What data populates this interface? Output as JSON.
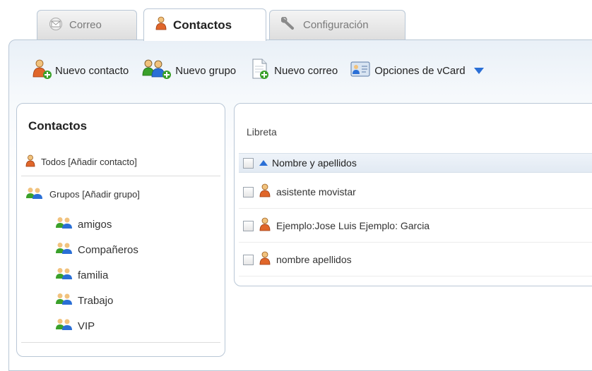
{
  "tabs": [
    {
      "label": "Correo",
      "icon": "envelope-icon",
      "active": false
    },
    {
      "label": "Contactos",
      "icon": "person-icon",
      "active": true
    },
    {
      "label": "Configuración",
      "icon": "wrench-icon",
      "active": false
    }
  ],
  "toolbar": {
    "new_contact": "Nuevo contacto",
    "new_group": "Nuevo grupo",
    "new_mail": "Nuevo correo",
    "vcard_options": "Opciones de vCard"
  },
  "left_panel": {
    "title": "Contactos",
    "all_label": "Todos [Añadir contacto]",
    "groups_label": "Grupos [Añadir grupo]",
    "groups": [
      "amigos",
      "Compañeros",
      "familia",
      "Trabajo",
      "VIP"
    ]
  },
  "right_panel": {
    "title": "Libreta",
    "column_header": "Nombre y apellidos",
    "rows": [
      "asistente movistar",
      "Ejemplo:Jose Luis Ejemplo: Garcia",
      "nombre apellidos"
    ]
  },
  "colors": {
    "accent": "#2a6fd6",
    "border": "#b9c7d6",
    "person_orange": "#e0662a",
    "group_green": "#3aa02a"
  }
}
